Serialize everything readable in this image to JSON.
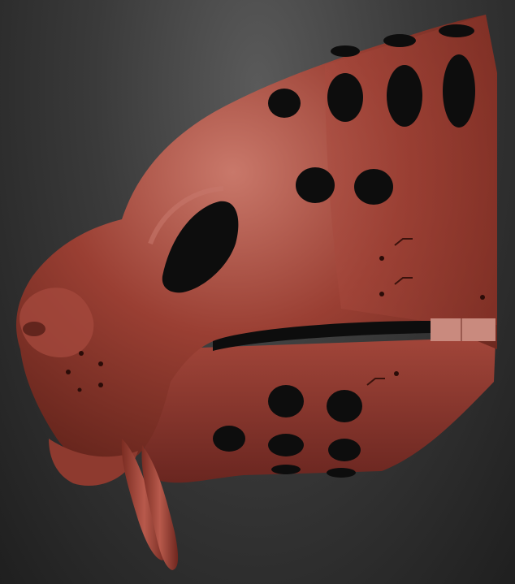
{
  "scene": {
    "subject": "",
    "material_colors": {
      "base": "#9a3f33",
      "highlight": "#c9786a",
      "shadow": "#5a1f17",
      "hole": "#0d0d0d"
    },
    "background_colors": {
      "top": "#5a5a5a",
      "bottom": "#1f1f1f"
    }
  }
}
